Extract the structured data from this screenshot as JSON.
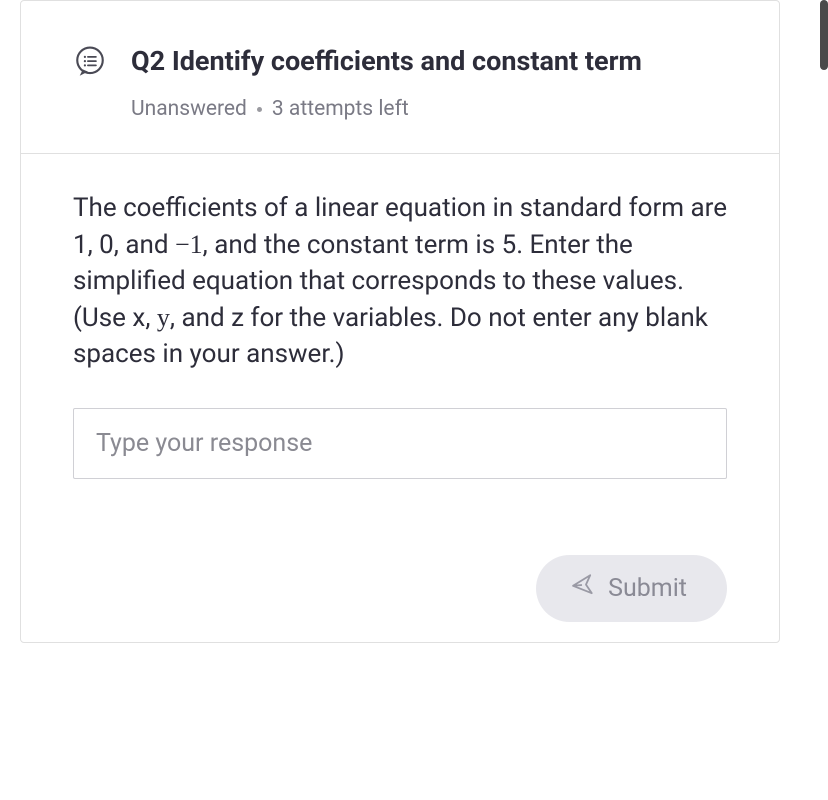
{
  "question": {
    "title": "Q2 Identify coefficients and constant term",
    "status_unanswered": "Unanswered",
    "status_attempts": "3 attempts left",
    "body_pre": "The coefficients of a linear equation in standard form are 1, 0, and ",
    "body_neg": "−1",
    "body_mid": ", and the constant term is 5. Enter the simplified equation that corresponds to these values. (Use x, ",
    "body_y": "y",
    "body_post": ", and z for the variables. Do not enter any blank spaces in your answer.)"
  },
  "input": {
    "placeholder": "Type your response",
    "value": ""
  },
  "submit": {
    "label": "Submit"
  }
}
